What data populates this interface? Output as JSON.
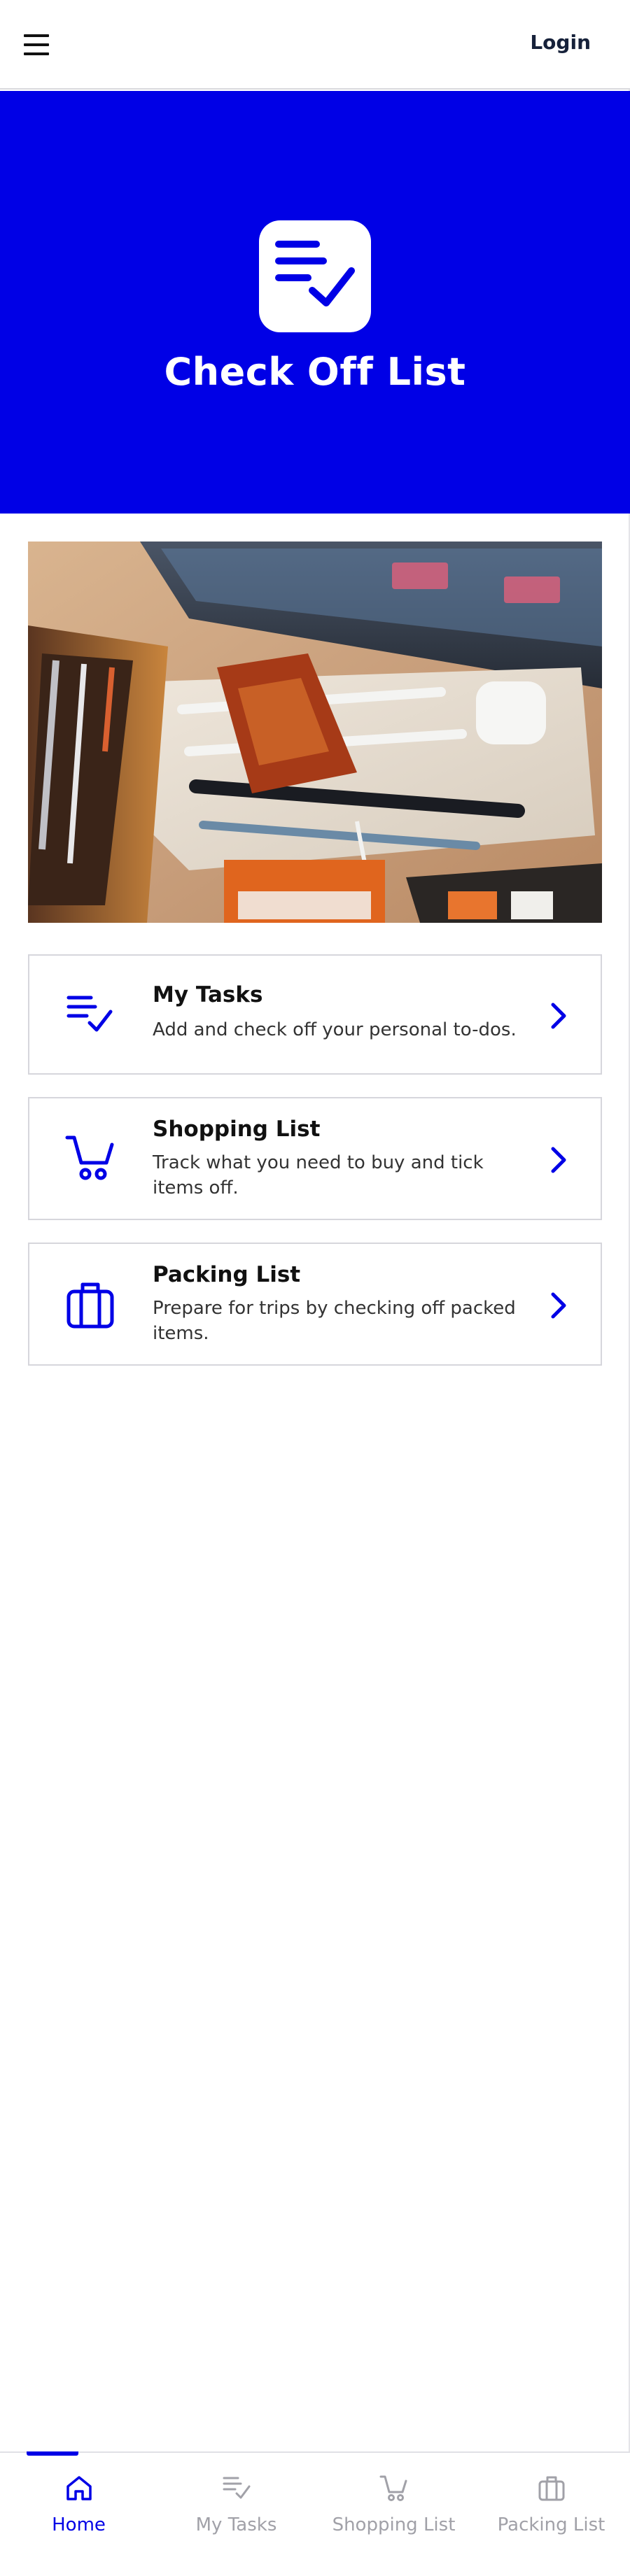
{
  "header": {
    "menu_icon": "hamburger-menu-icon",
    "login_label": "Login"
  },
  "hero": {
    "logo_icon": "checklist-icon",
    "title": "Check Off List",
    "background_color": "#0000e6"
  },
  "photo": {
    "subject": "desk with pencil case, pens, snack packet and earbuds"
  },
  "cards": [
    {
      "icon": "checklist-icon",
      "title": "My Tasks",
      "description": "Add and check off your personal to-dos.",
      "chevron_icon": "chevron-right-icon"
    },
    {
      "icon": "shopping-cart-icon",
      "title": "Shopping List",
      "description": "Track what you need to buy and tick items off.",
      "chevron_icon": "chevron-right-icon"
    },
    {
      "icon": "suitcase-icon",
      "title": "Packing List",
      "description": "Prepare for trips by checking off packed items.",
      "chevron_icon": "chevron-right-icon"
    }
  ],
  "bottom_nav": {
    "items": [
      {
        "label": "Home",
        "icon": "home-icon",
        "active": true
      },
      {
        "label": "My Tasks",
        "icon": "checklist-icon",
        "active": false
      },
      {
        "label": "Shopping List",
        "icon": "shopping-cart-icon",
        "active": false
      },
      {
        "label": "Packing List",
        "icon": "suitcase-icon",
        "active": false
      }
    ]
  },
  "colors": {
    "accent": "#0000e6",
    "inactive": "#a1a1a8",
    "border": "#d6d6dc"
  }
}
